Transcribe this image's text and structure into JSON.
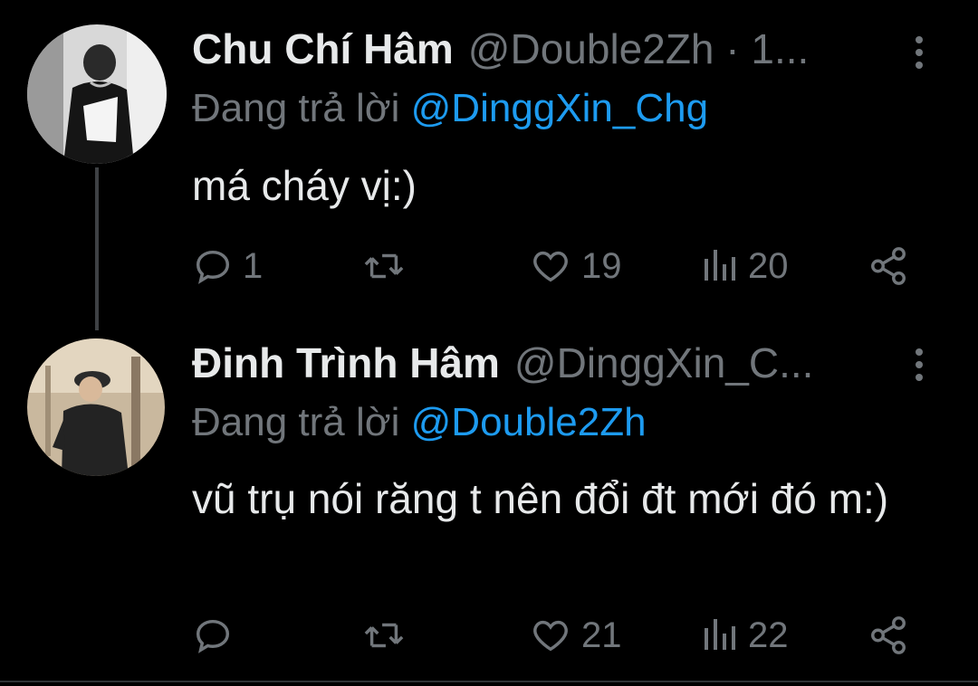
{
  "colors": {
    "background": "#000000",
    "text": "#e7e9ea",
    "muted": "#71767b",
    "accent": "#1d9bf0",
    "thread_line": "#3e4144"
  },
  "tweets": [
    {
      "display_name": "Chu Chí Hâm",
      "handle_time": "@Double2Zh · 1...",
      "reply_prefix": "Đang trả lời",
      "reply_to": "@DinggXin_Chg",
      "text": "má cháy vị:)",
      "avatar_icon": "user-avatar-photo",
      "more_icon": "more-vertical-icon",
      "actions": {
        "reply_count": "1",
        "retweet_count": "",
        "like_count": "19",
        "views_count": "20"
      }
    },
    {
      "display_name": "Đinh Trình Hâm",
      "handle_time": "@DinggXin_C...",
      "reply_prefix": "Đang trả lời",
      "reply_to": "@Double2Zh",
      "text": "vũ trụ nói răng t nên đổi đt mới đó m:)",
      "avatar_icon": "user-avatar-photo",
      "more_icon": "more-vertical-icon",
      "actions": {
        "reply_count": "",
        "retweet_count": "",
        "like_count": "21",
        "views_count": "22"
      }
    }
  ]
}
